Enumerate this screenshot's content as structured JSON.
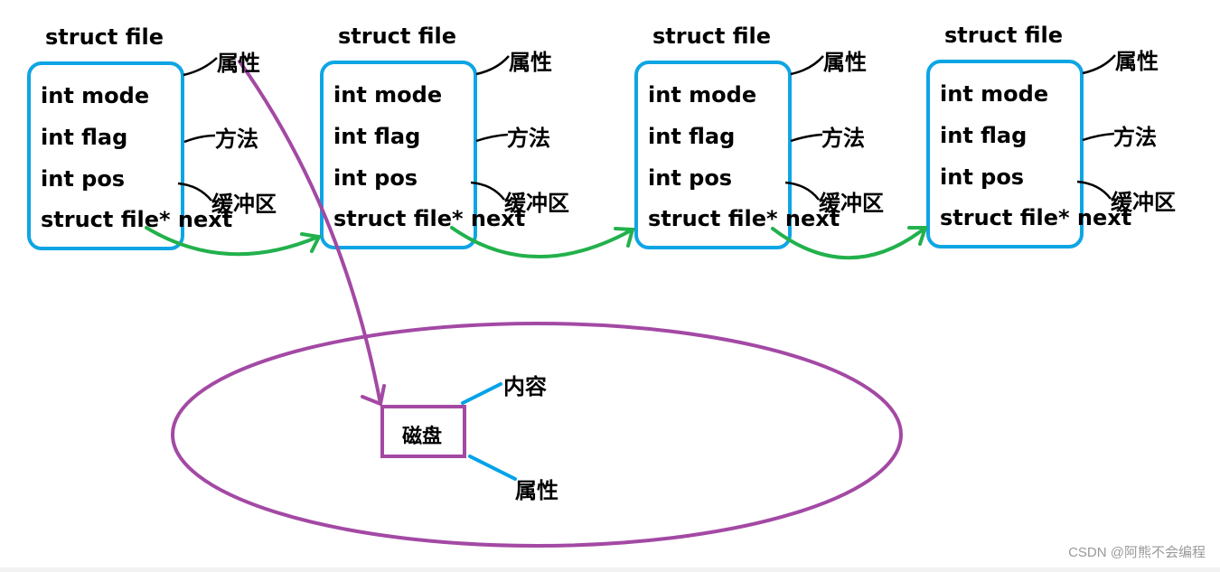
{
  "nodes": [
    {
      "title": "struct file",
      "fields": [
        "int mode",
        "int flag",
        "int pos",
        "struct file* next"
      ],
      "notes": [
        "属性",
        "方法",
        "缓冲区"
      ]
    },
    {
      "title": "struct file",
      "fields": [
        "int mode",
        "int flag",
        "int pos",
        "struct file* next"
      ],
      "notes": [
        "属性",
        "方法",
        "缓冲区"
      ]
    },
    {
      "title": "struct file",
      "fields": [
        "int mode",
        "int flag",
        "int pos",
        "struct file* next"
      ],
      "notes": [
        "属性",
        "方法",
        "缓冲区"
      ]
    },
    {
      "title": "struct file",
      "fields": [
        "int mode",
        "int flag",
        "int pos",
        "struct file* next"
      ],
      "notes": [
        "属性",
        "方法",
        "缓冲区"
      ]
    }
  ],
  "disk": {
    "label": "磁盘",
    "notes": [
      "内容",
      "属性"
    ]
  },
  "colors": {
    "node_border": "#0ea5e4",
    "link_arrow": "#22b14c",
    "disk": "#a349a4",
    "disk_note_line": "#00a2e8",
    "note_line": "#000000"
  },
  "watermark": "CSDN @阿熊不会编程"
}
